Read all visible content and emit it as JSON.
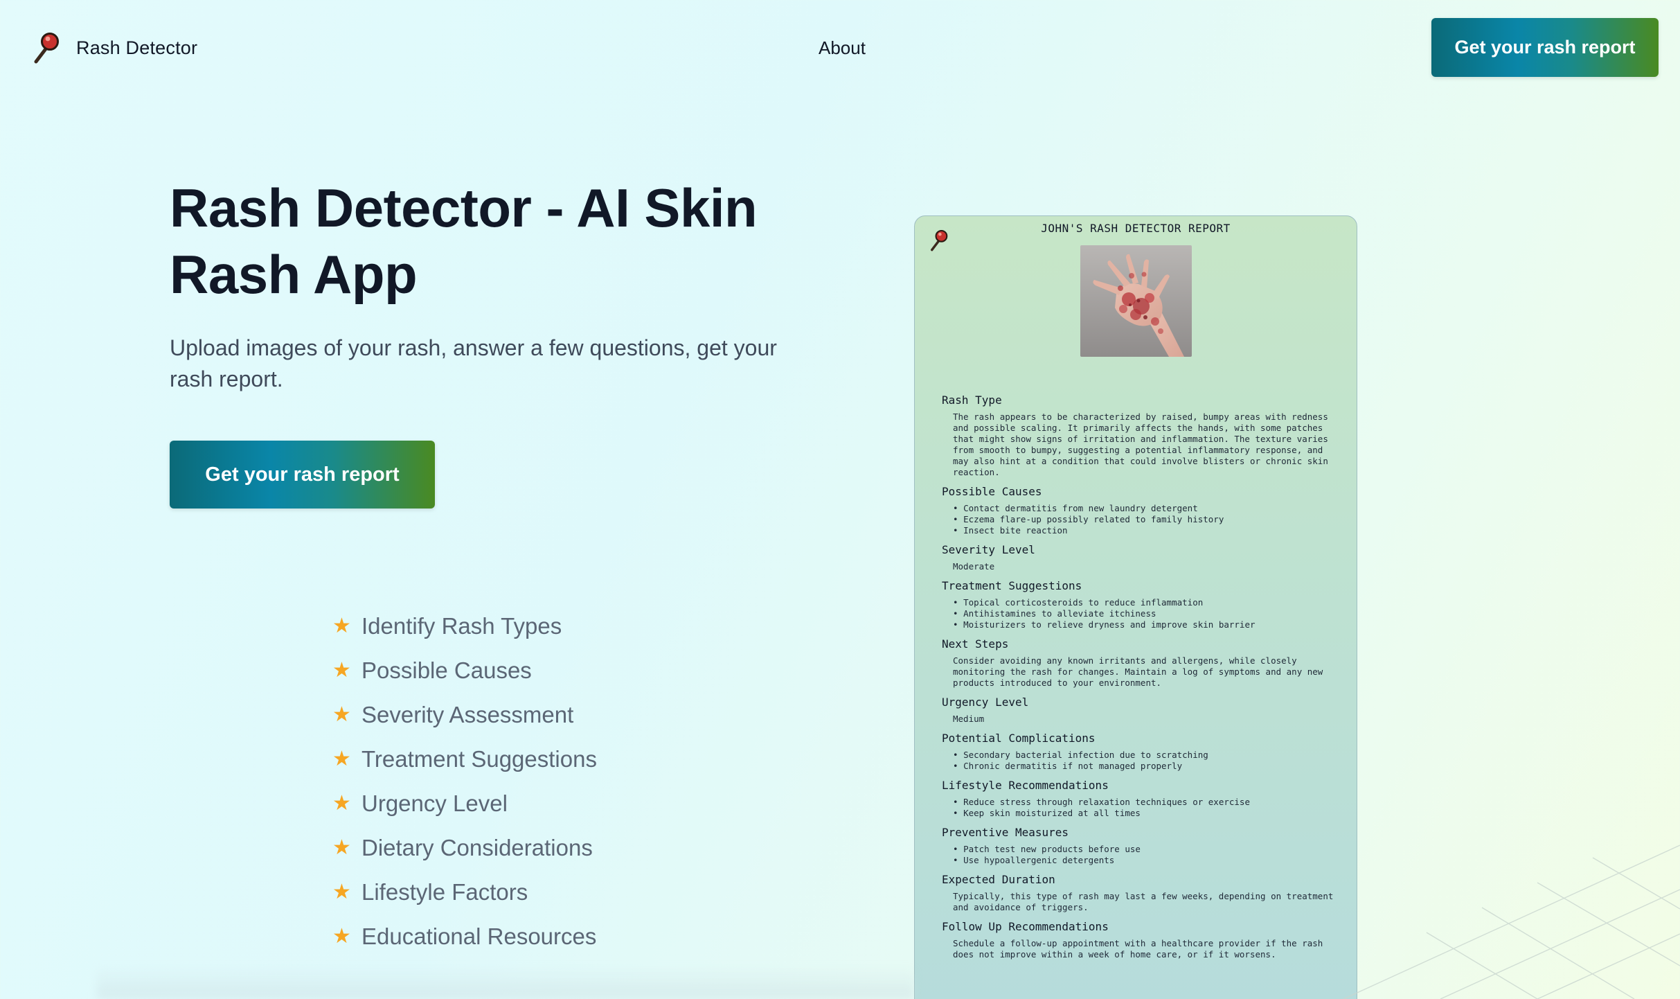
{
  "nav": {
    "brand_name": "Rash Detector",
    "brand_icon": "magnifying-glass-icon",
    "about_label": "About",
    "cta_label": "Get your rash report"
  },
  "hero": {
    "title": "Rash Detector - AI Skin Rash App",
    "subtitle": "Upload images of your rash, answer a few questions, get your rash report.",
    "cta_label": "Get your rash report"
  },
  "features": [
    "Identify Rash Types",
    "Possible Causes",
    "Severity Assessment",
    "Treatment Suggestions",
    "Urgency Level",
    "Dietary Considerations",
    "Lifestyle Factors",
    "Educational Resources"
  ],
  "report": {
    "title": "JOHN'S RASH DETECTOR REPORT",
    "image_subject": "hand with red rash",
    "sections": [
      {
        "heading": "Rash Type",
        "text": "The rash appears to be characterized by raised, bumpy areas with redness and possible scaling. It primarily affects the hands, with some patches that might show signs of irritation and inflammation. The texture varies from smooth to bumpy, suggesting a potential inflammatory response, and may also hint at a condition that could involve blisters or chronic skin reaction."
      },
      {
        "heading": "Possible Causes",
        "items": [
          "Contact dermatitis from new laundry detergent",
          "Eczema flare-up possibly related to family history",
          "Insect bite reaction"
        ]
      },
      {
        "heading": "Severity Level",
        "text": "Moderate"
      },
      {
        "heading": "Treatment Suggestions",
        "items": [
          "Topical corticosteroids to reduce inflammation",
          "Antihistamines to alleviate itchiness",
          "Moisturizers to relieve dryness and improve skin barrier"
        ]
      },
      {
        "heading": "Next Steps",
        "text": "Consider avoiding any known irritants and allergens, while closely monitoring the rash for changes. Maintain a log of symptoms and any new products introduced to your environment."
      },
      {
        "heading": "Urgency Level",
        "text": "Medium"
      },
      {
        "heading": "Potential Complications",
        "items": [
          "Secondary bacterial infection due to scratching",
          "Chronic dermatitis if not managed properly"
        ]
      },
      {
        "heading": "Lifestyle Recommendations",
        "items": [
          "Reduce stress through relaxation techniques or exercise",
          "Keep skin moisturized at all times"
        ]
      },
      {
        "heading": "Preventive Measures",
        "items": [
          "Patch test new products before use",
          "Use hypoallergenic detergents"
        ]
      },
      {
        "heading": "Expected Duration",
        "text": "Typically, this type of rash may last a few weeks, depending on treatment and avoidance of triggers."
      },
      {
        "heading": "Follow Up Recommendations",
        "text": "Schedule a follow-up appointment with a healthcare provider if the rash does not improve within a week of home care, or if it worsens."
      }
    ]
  },
  "colors": {
    "accent_star": "#f6a623",
    "cta_gradient_start": "#0b6a78",
    "cta_gradient_mid": "#0a86a8",
    "cta_gradient_end": "#4a8a22",
    "heading_text": "#111827",
    "muted_text": "#5b6675"
  }
}
